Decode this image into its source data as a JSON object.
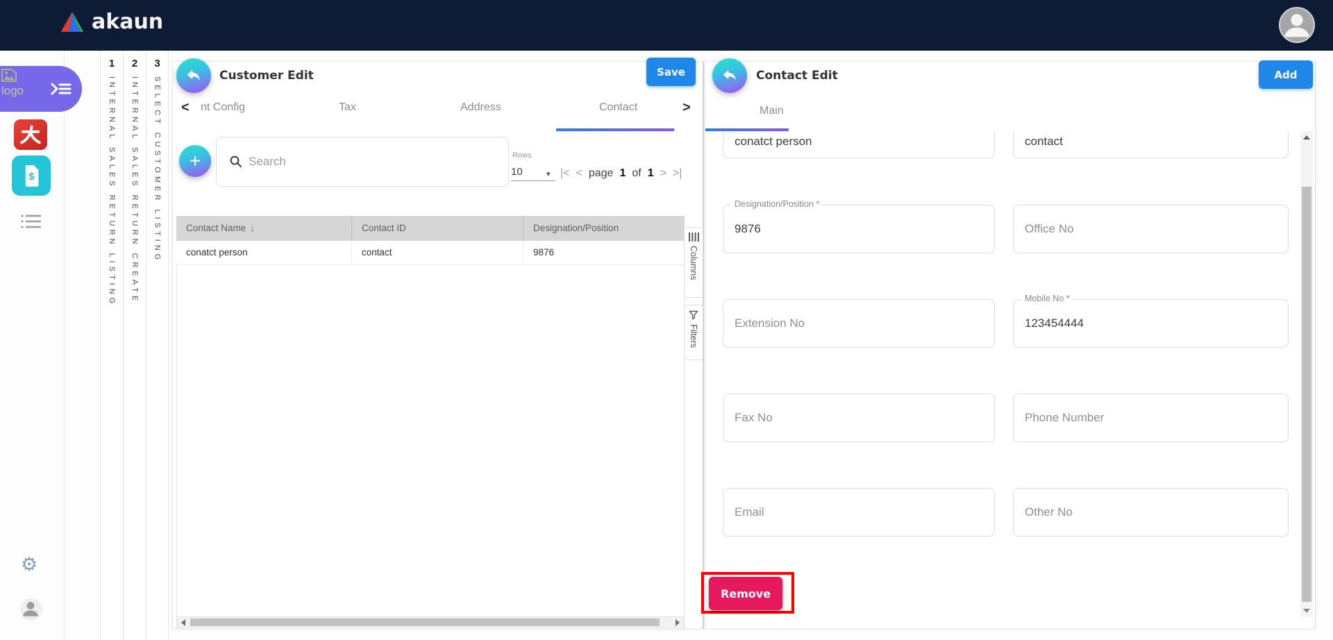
{
  "colors": {
    "header_navy": "#0d1c34",
    "accent_blue": "#1f87e8",
    "gradient_teal": "#2ce2c6",
    "gradient_purple": "#a84ff2",
    "banner_purple": "#7668e8",
    "tile_red": "#d8302f",
    "tile_cyan": "#25c5d8",
    "remove_pink": "#e8185e",
    "annotation_red": "#fe0000",
    "table_header_gray": "#d6d6d6"
  },
  "header": {
    "brand": "akaun"
  },
  "sidebar": {
    "logo_text": "logo",
    "icons": [
      "broken-image-icon",
      "menu-expand-icon",
      "chinese-char-app-icon",
      "billing-doc-icon",
      "list-icon",
      "gear-icon",
      "user-icon"
    ]
  },
  "steps": [
    {
      "number": "1",
      "label": "INTERNAL SALES RETURN LISTING"
    },
    {
      "number": "2",
      "label": "INTERNAL SALES RETURN CREATE"
    },
    {
      "number": "3",
      "label": "SELECT CUSTOMER LISTING"
    }
  ],
  "customer_panel": {
    "title": "Customer Edit",
    "save_label": "Save",
    "tabs": [
      {
        "label": "nt Config"
      },
      {
        "label": "Tax"
      },
      {
        "label": "Address"
      },
      {
        "label": "Contact",
        "active": true
      }
    ],
    "toolbar": {
      "search_placeholder": "Search",
      "rows_label": "Rows",
      "rows_value": "10"
    },
    "pagination": {
      "page_word": "page",
      "current": "1",
      "of_word": "of",
      "total": "1"
    },
    "table": {
      "columns": [
        "Contact Name",
        "Contact ID",
        "Designation/Position"
      ],
      "rows": [
        [
          "conatct person",
          "contact",
          "9876"
        ]
      ]
    },
    "side_tools": {
      "columns": "Columns",
      "filters": "Filters"
    }
  },
  "contact_panel": {
    "title": "Contact Edit",
    "add_label": "Add",
    "tab": "Main",
    "fields": {
      "contact_name": {
        "value": "conatct person"
      },
      "contact_id": {
        "value": "contact"
      },
      "designation": {
        "label": "Designation/Position *",
        "value": "9876"
      },
      "office_no": {
        "placeholder": "Office No"
      },
      "extension_no": {
        "placeholder": "Extension No"
      },
      "mobile_no": {
        "label": "Mobile No *",
        "value": "123454444"
      },
      "fax_no": {
        "placeholder": "Fax No"
      },
      "phone_number": {
        "placeholder": "Phone Number"
      },
      "email": {
        "placeholder": "Email"
      },
      "other_no": {
        "placeholder": "Other No"
      }
    },
    "remove_label": "Remove"
  },
  "glyphs": {
    "app_tile_char": "大",
    "tab_prev": "<",
    "tab_next": ">",
    "sort_desc": "↓",
    "caret_down": "▾",
    "page_first": "|<",
    "page_prev": "<",
    "page_next": ">",
    "page_last": ">|",
    "gear": "⚙",
    "plus": "+"
  }
}
